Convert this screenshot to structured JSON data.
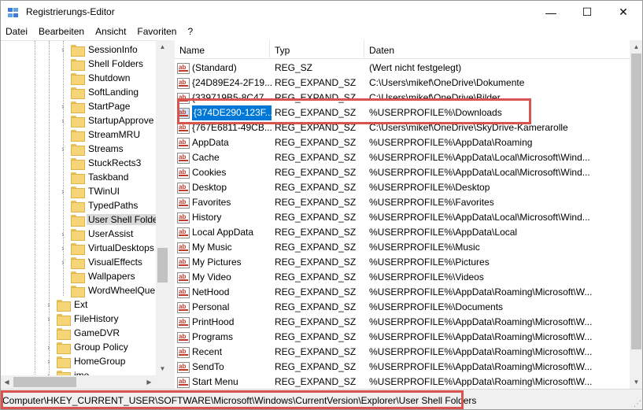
{
  "window": {
    "title": "Registrierungs-Editor",
    "minimize_glyph": "—",
    "maximize_glyph": "☐",
    "close_glyph": "✕"
  },
  "menu": [
    "Datei",
    "Bearbeiten",
    "Ansicht",
    "Favoriten",
    "?"
  ],
  "tree": [
    {
      "label": "SessionInfo",
      "expander": "›",
      "level": 2
    },
    {
      "label": "Shell Folders",
      "expander": "",
      "level": 2
    },
    {
      "label": "Shutdown",
      "expander": "",
      "level": 2
    },
    {
      "label": "SoftLanding",
      "expander": "",
      "level": 2
    },
    {
      "label": "StartPage",
      "expander": "›",
      "level": 2
    },
    {
      "label": "StartupApprove",
      "expander": "›",
      "level": 2
    },
    {
      "label": "StreamMRU",
      "expander": "",
      "level": 2
    },
    {
      "label": "Streams",
      "expander": "›",
      "level": 2
    },
    {
      "label": "StuckRects3",
      "expander": "",
      "level": 2
    },
    {
      "label": "Taskband",
      "expander": "",
      "level": 2
    },
    {
      "label": "TWinUI",
      "expander": "›",
      "level": 2
    },
    {
      "label": "TypedPaths",
      "expander": "",
      "level": 2
    },
    {
      "label": "User Shell Folde",
      "expander": "",
      "level": 2,
      "selected": true
    },
    {
      "label": "UserAssist",
      "expander": "›",
      "level": 2
    },
    {
      "label": "VirtualDesktops",
      "expander": "›",
      "level": 2
    },
    {
      "label": "VisualEffects",
      "expander": "›",
      "level": 2
    },
    {
      "label": "Wallpapers",
      "expander": "",
      "level": 2
    },
    {
      "label": "WordWheelQue",
      "expander": "",
      "level": 2
    },
    {
      "label": "Ext",
      "expander": "›",
      "level": 1
    },
    {
      "label": "FileHistory",
      "expander": "›",
      "level": 1
    },
    {
      "label": "GameDVR",
      "expander": "",
      "level": 1
    },
    {
      "label": "Group Policy",
      "expander": "›",
      "level": 1
    },
    {
      "label": "HomeGroup",
      "expander": "›",
      "level": 1
    },
    {
      "label": "ime",
      "expander": "›",
      "level": 1
    }
  ],
  "list": {
    "columns": [
      "Name",
      "Typ",
      "Daten"
    ],
    "rows": [
      {
        "name": "(Standard)",
        "type": "REG_SZ",
        "data": "(Wert nicht festgelegt)"
      },
      {
        "name": "{24D89E24-2F19...",
        "type": "REG_EXPAND_SZ",
        "data": "C:\\Users\\mikef\\OneDrive\\Dokumente"
      },
      {
        "name": "{339719B5-8C47...",
        "type": "REG_EXPAND_SZ",
        "data": "C:\\Users\\mikef\\OneDrive\\Bilder"
      },
      {
        "name": "{374DE290-123F...",
        "type": "REG_EXPAND_SZ",
        "data": "%USERPROFILE%\\Downloads",
        "selected": true
      },
      {
        "name": "{767E6811-49CB...",
        "type": "REG_EXPAND_SZ",
        "data": "C:\\Users\\mikef\\OneDrive\\SkyDrive-Kamerarolle"
      },
      {
        "name": "AppData",
        "type": "REG_EXPAND_SZ",
        "data": "%USERPROFILE%\\AppData\\Roaming"
      },
      {
        "name": "Cache",
        "type": "REG_EXPAND_SZ",
        "data": "%USERPROFILE%\\AppData\\Local\\Microsoft\\Wind..."
      },
      {
        "name": "Cookies",
        "type": "REG_EXPAND_SZ",
        "data": "%USERPROFILE%\\AppData\\Local\\Microsoft\\Wind..."
      },
      {
        "name": "Desktop",
        "type": "REG_EXPAND_SZ",
        "data": "%USERPROFILE%\\Desktop"
      },
      {
        "name": "Favorites",
        "type": "REG_EXPAND_SZ",
        "data": "%USERPROFILE%\\Favorites"
      },
      {
        "name": "History",
        "type": "REG_EXPAND_SZ",
        "data": "%USERPROFILE%\\AppData\\Local\\Microsoft\\Wind..."
      },
      {
        "name": "Local AppData",
        "type": "REG_EXPAND_SZ",
        "data": "%USERPROFILE%\\AppData\\Local"
      },
      {
        "name": "My Music",
        "type": "REG_EXPAND_SZ",
        "data": "%USERPROFILE%\\Music"
      },
      {
        "name": "My Pictures",
        "type": "REG_EXPAND_SZ",
        "data": "%USERPROFILE%\\Pictures"
      },
      {
        "name": "My Video",
        "type": "REG_EXPAND_SZ",
        "data": "%USERPROFILE%\\Videos"
      },
      {
        "name": "NetHood",
        "type": "REG_EXPAND_SZ",
        "data": "%USERPROFILE%\\AppData\\Roaming\\Microsoft\\W..."
      },
      {
        "name": "Personal",
        "type": "REG_EXPAND_SZ",
        "data": "%USERPROFILE%\\Documents"
      },
      {
        "name": "PrintHood",
        "type": "REG_EXPAND_SZ",
        "data": "%USERPROFILE%\\AppData\\Roaming\\Microsoft\\W..."
      },
      {
        "name": "Programs",
        "type": "REG_EXPAND_SZ",
        "data": "%USERPROFILE%\\AppData\\Roaming\\Microsoft\\W..."
      },
      {
        "name": "Recent",
        "type": "REG_EXPAND_SZ",
        "data": "%USERPROFILE%\\AppData\\Roaming\\Microsoft\\W..."
      },
      {
        "name": "SendTo",
        "type": "REG_EXPAND_SZ",
        "data": "%USERPROFILE%\\AppData\\Roaming\\Microsoft\\W..."
      },
      {
        "name": "Start Menu",
        "type": "REG_EXPAND_SZ",
        "data": "%USERPROFILE%\\AppData\\Roaming\\Microsoft\\W..."
      }
    ]
  },
  "value_icon": "ab",
  "statusbar": {
    "path": "Computer\\HKEY_CURRENT_USER\\SOFTWARE\\Microsoft\\Windows\\CurrentVersion\\Explorer\\User Shell Folders"
  },
  "colors": {
    "selection": "#0078d7",
    "highlight_box": "#d9534f",
    "folder": "#f5d577"
  }
}
